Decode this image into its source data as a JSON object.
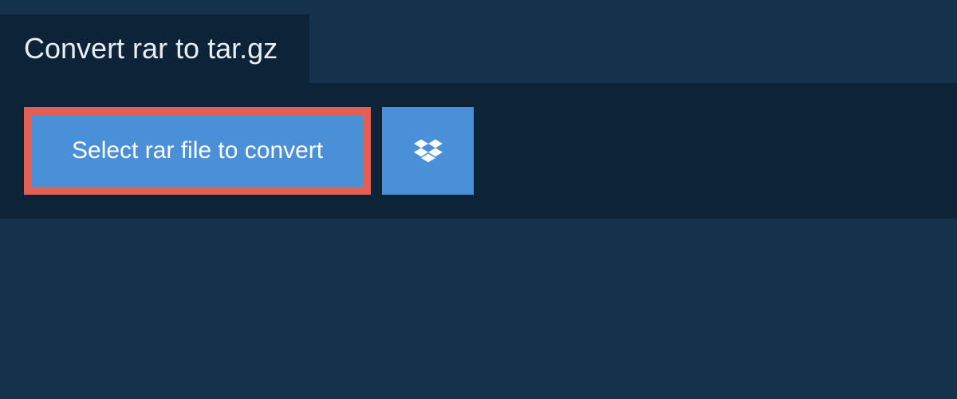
{
  "header": {
    "title": "Convert rar to tar.gz"
  },
  "actions": {
    "select_file_label": "Select rar file to convert",
    "dropbox_icon_name": "dropbox"
  },
  "colors": {
    "page_bg": "#15324c",
    "panel_bg": "#0d2438",
    "button_bg": "#4a90d9",
    "highlight_border": "#e15f55",
    "text_light": "#e8eef4"
  }
}
